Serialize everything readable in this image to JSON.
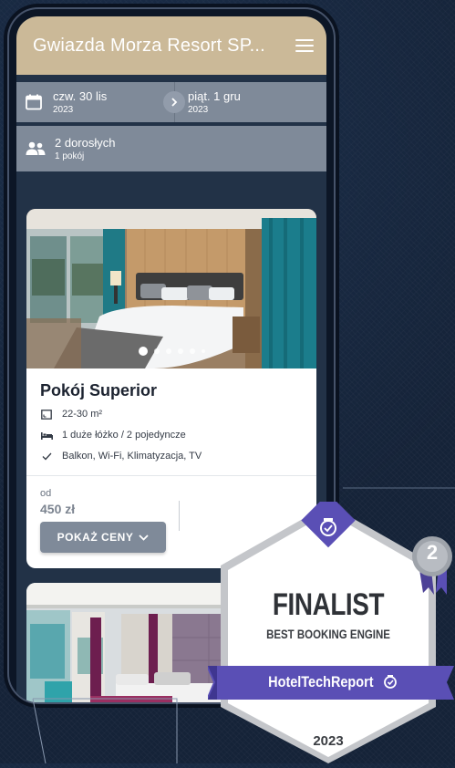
{
  "header": {
    "title": "Gwiazda Morza Resort SP..."
  },
  "booking": {
    "checkin": {
      "day": "czw. 30 lis",
      "year": "2023"
    },
    "checkout": {
      "day": "piąt. 1 gru",
      "year": "2023"
    },
    "guests": {
      "adults": "2 dorosłych",
      "rooms": "1 pokój"
    }
  },
  "room": {
    "title": "Pokój Superior",
    "features": [
      {
        "icon": "area-icon",
        "text": "22-30 m²"
      },
      {
        "icon": "bed-icon",
        "text": "1 duże łóżko / 2 pojedyncze"
      },
      {
        "icon": "check-icon",
        "text": "Balkon, Wi-Fi, Klimatyzacja, TV"
      }
    ],
    "price_from": "od",
    "price": "450 zł",
    "show_prices": "POKAŻ CENY",
    "carousel_active": 1,
    "carousel_count": 6
  },
  "award": {
    "title": "FINALIST",
    "subtitle": "BEST BOOKING ENGINE",
    "brand": "HotelTechReport",
    "rank": "2",
    "year": "2023"
  },
  "colors": {
    "header": "#cbb998",
    "bar": "#7f8a99",
    "award": "#5a4fb5"
  }
}
